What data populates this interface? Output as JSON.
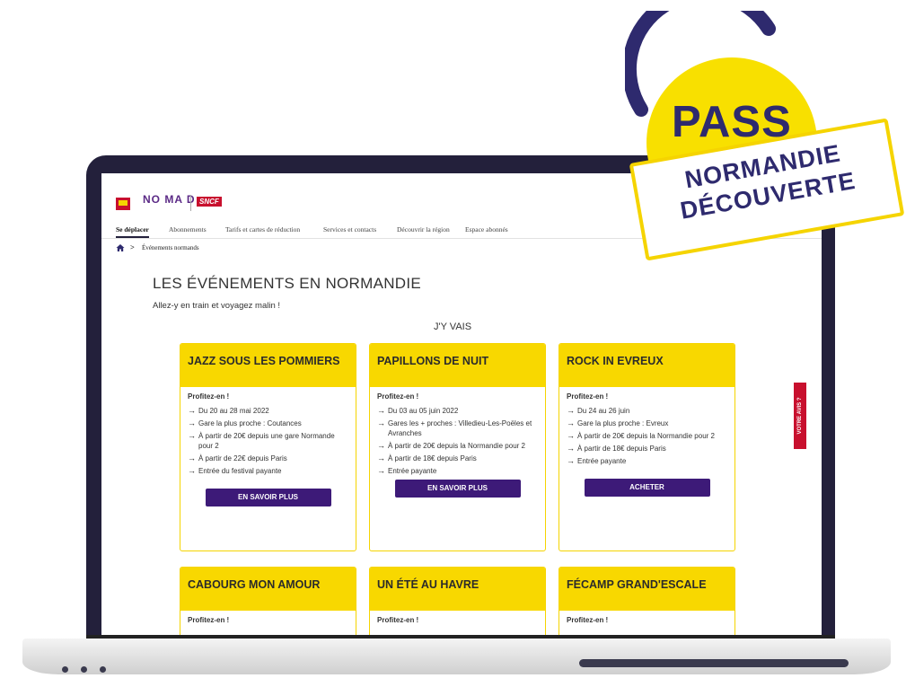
{
  "header": {
    "logo_text": "NO MA D",
    "sncf_text": "SNCF"
  },
  "nav": {
    "items": [
      {
        "label": "Se déplacer",
        "active": true
      },
      {
        "label": "Abonnements"
      },
      {
        "label": "Tarifs et cartes de réduction"
      },
      {
        "label": "Services et contacts"
      },
      {
        "label": "Découvrir la région"
      },
      {
        "label": "Espace abonnés"
      }
    ]
  },
  "breadcrumb": {
    "separator": ">",
    "current": "Événements normands"
  },
  "page": {
    "title": "LES ÉVÉNEMENTS EN NORMANDIE",
    "subtitle": "Allez-y en train et voyagez malin !",
    "section_title": "J'Y VAIS"
  },
  "cards": [
    {
      "title": "JAZZ SOUS LES POMMIERS",
      "kicker": "Profitez-en !",
      "bullets": [
        "Du 20 au 28 mai 2022",
        "Gare la plus proche : Coutances",
        "À partir de 20€ depuis une gare Normande pour 2",
        "À partir de 22€ depuis Paris",
        "Entrée du festival payante"
      ],
      "button": "EN SAVOIR PLUS"
    },
    {
      "title": "PAPILLONS DE NUIT",
      "kicker": "Profitez-en !",
      "bullets": [
        "Du 03 au 05 juin 2022",
        "Gares les + proches : Villedieu-Les-Poëles et Avranches",
        "À partir de 20€ depuis la Normandie pour 2",
        "À partir de 18€ depuis Paris",
        "Entrée payante"
      ],
      "button": "EN SAVOIR PLUS"
    },
    {
      "title": "ROCK IN EVREUX",
      "kicker": "Profitez-en !",
      "bullets": [
        "Du 24 au 26 juin",
        "Gare la plus proche : Evreux",
        "À partir de 20€ depuis la Normandie pour 2",
        "À partir de 18€ depuis Paris",
        "Entrée payante"
      ],
      "button": "ACHETER"
    },
    {
      "title": "CABOURG MON AMOUR",
      "kicker": "Profitez-en !",
      "bullets": [],
      "button": ""
    },
    {
      "title": "UN ÉTÉ AU HAVRE",
      "kicker": "Profitez-en !",
      "bullets": [],
      "button": ""
    },
    {
      "title": "FÉCAMP GRAND'ESCALE",
      "kicker": "Profitez-en !",
      "bullets": [],
      "button": ""
    }
  ],
  "feedback_tab": "VOTRE AVIS ?",
  "badge": {
    "pass": "PASS",
    "line1": "NORMANDIE",
    "line2": "DÉCOUVERTE"
  },
  "colors": {
    "yellow": "#f8d800",
    "purple": "#3d1a78",
    "navy": "#2e2a6e",
    "red": "#c8102e",
    "laptop": "#23203b"
  }
}
